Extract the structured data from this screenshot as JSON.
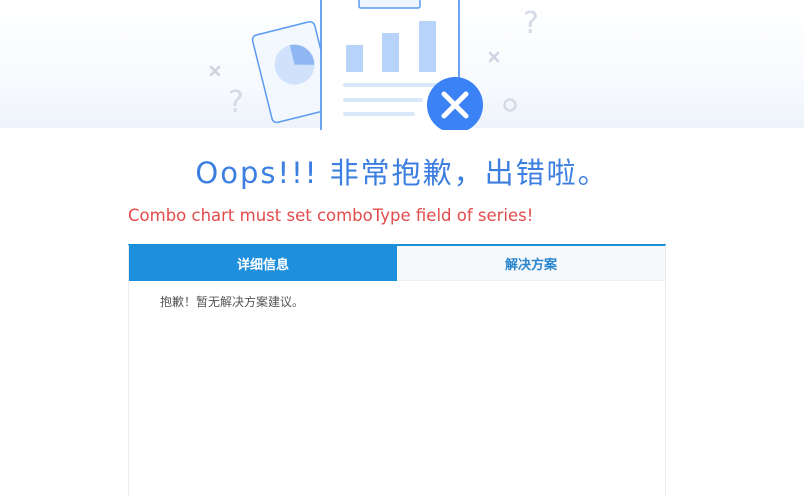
{
  "title": "Oops!!! 非常抱歉，出错啦。",
  "error_message": "Combo chart must set comboType field of series!",
  "tabs": [
    {
      "label": "详细信息",
      "active": true
    },
    {
      "label": "解决方案",
      "active": false
    }
  ],
  "detail_text": "抱歉！暂无解决方案建议。",
  "colors": {
    "title": "#3d7fe0",
    "error": "#e34b4b",
    "tab_active_bg": "#1e8fdc",
    "tab_inactive_text": "#2b86cf",
    "error_badge": "#3b82f6"
  },
  "illustration": {
    "icons": [
      "pie-chart-card",
      "clipboard-bar-chart",
      "error-x-badge",
      "question-mark",
      "x-mark",
      "circle-dot"
    ]
  }
}
